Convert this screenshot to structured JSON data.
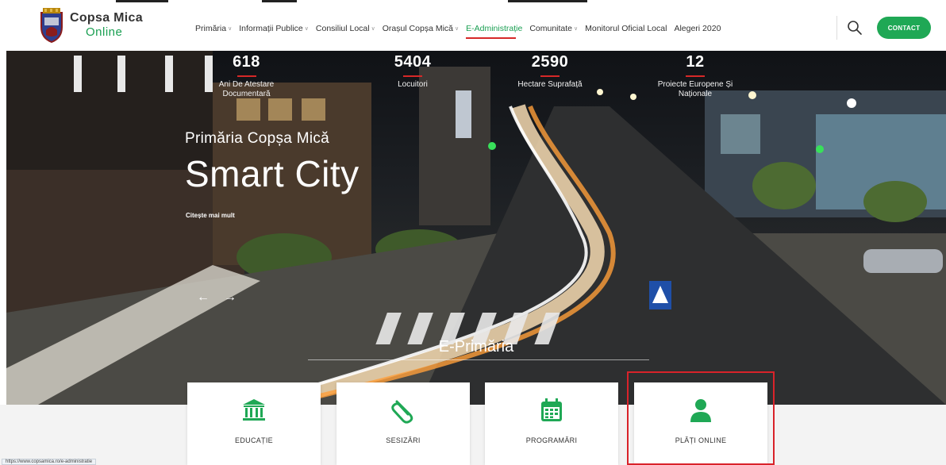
{
  "site": {
    "name": "Copsa Mica",
    "subtitle": "Online"
  },
  "nav": {
    "items": [
      {
        "label": "Primăria",
        "dropdown": true,
        "active": false
      },
      {
        "label": "Informații Publice",
        "dropdown": true,
        "active": false
      },
      {
        "label": "Consiliul Local",
        "dropdown": true,
        "active": false
      },
      {
        "label": "Orașul Copșa Mică",
        "dropdown": true,
        "active": false
      },
      {
        "label": "E-Administrație",
        "dropdown": false,
        "active": true
      },
      {
        "label": "Comunitate",
        "dropdown": true,
        "active": false
      },
      {
        "label": "Monitorul Oficial Local",
        "dropdown": false,
        "active": false
      },
      {
        "label": "Alegeri 2020",
        "dropdown": false,
        "active": false
      }
    ],
    "search_icon": "search-icon",
    "contact_label": "CONTACT"
  },
  "stats": [
    {
      "value": "618",
      "label": "Ani De Atestare Documentară"
    },
    {
      "value": "5404",
      "label": "Locuitori"
    },
    {
      "value": "2590",
      "label": "Hectare Suprafață"
    },
    {
      "value": "12",
      "label": "Proiecte Europene Și Naționale"
    }
  ],
  "hero": {
    "subtitle": "Primăria Copșa Mică",
    "title": "Smart City",
    "link": "Citește mai mult",
    "prev_icon": "arrow-left-icon",
    "next_icon": "arrow-right-icon"
  },
  "section": {
    "title": "E-Primăria"
  },
  "cards": [
    {
      "label": "EDUCAȚIE",
      "icon": "institution-icon"
    },
    {
      "label": "SESIZĂRI",
      "icon": "paperclip-icon"
    },
    {
      "label": "PROGRAMĂRI",
      "icon": "calendar-icon"
    },
    {
      "label": "PLĂȚI ONLINE",
      "icon": "user-icon"
    }
  ],
  "status": {
    "url": "https://www.copsamica.ro/e-administratie"
  },
  "colors": {
    "brand_green": "#1fa855",
    "accent_red": "#d62828",
    "highlight_red": "#d9232a"
  }
}
